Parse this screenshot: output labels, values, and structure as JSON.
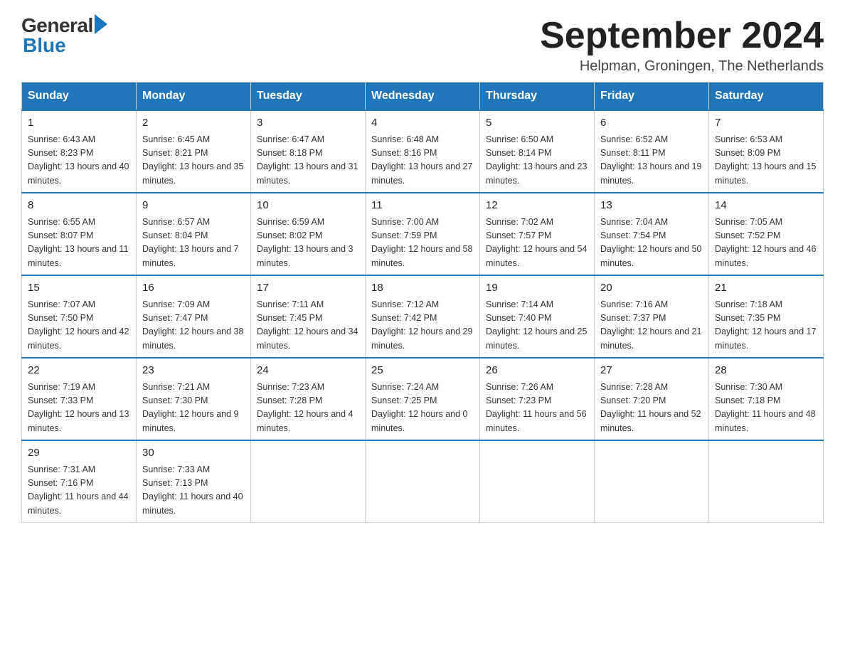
{
  "logo": {
    "general": "General",
    "blue": "Blue"
  },
  "header": {
    "month_year": "September 2024",
    "location": "Helpman, Groningen, The Netherlands"
  },
  "weekdays": [
    "Sunday",
    "Monday",
    "Tuesday",
    "Wednesday",
    "Thursday",
    "Friday",
    "Saturday"
  ],
  "weeks": [
    [
      {
        "day": "1",
        "sunrise": "6:43 AM",
        "sunset": "8:23 PM",
        "daylight": "13 hours and 40 minutes."
      },
      {
        "day": "2",
        "sunrise": "6:45 AM",
        "sunset": "8:21 PM",
        "daylight": "13 hours and 35 minutes."
      },
      {
        "day": "3",
        "sunrise": "6:47 AM",
        "sunset": "8:18 PM",
        "daylight": "13 hours and 31 minutes."
      },
      {
        "day": "4",
        "sunrise": "6:48 AM",
        "sunset": "8:16 PM",
        "daylight": "13 hours and 27 minutes."
      },
      {
        "day": "5",
        "sunrise": "6:50 AM",
        "sunset": "8:14 PM",
        "daylight": "13 hours and 23 minutes."
      },
      {
        "day": "6",
        "sunrise": "6:52 AM",
        "sunset": "8:11 PM",
        "daylight": "13 hours and 19 minutes."
      },
      {
        "day": "7",
        "sunrise": "6:53 AM",
        "sunset": "8:09 PM",
        "daylight": "13 hours and 15 minutes."
      }
    ],
    [
      {
        "day": "8",
        "sunrise": "6:55 AM",
        "sunset": "8:07 PM",
        "daylight": "13 hours and 11 minutes."
      },
      {
        "day": "9",
        "sunrise": "6:57 AM",
        "sunset": "8:04 PM",
        "daylight": "13 hours and 7 minutes."
      },
      {
        "day": "10",
        "sunrise": "6:59 AM",
        "sunset": "8:02 PM",
        "daylight": "13 hours and 3 minutes."
      },
      {
        "day": "11",
        "sunrise": "7:00 AM",
        "sunset": "7:59 PM",
        "daylight": "12 hours and 58 minutes."
      },
      {
        "day": "12",
        "sunrise": "7:02 AM",
        "sunset": "7:57 PM",
        "daylight": "12 hours and 54 minutes."
      },
      {
        "day": "13",
        "sunrise": "7:04 AM",
        "sunset": "7:54 PM",
        "daylight": "12 hours and 50 minutes."
      },
      {
        "day": "14",
        "sunrise": "7:05 AM",
        "sunset": "7:52 PM",
        "daylight": "12 hours and 46 minutes."
      }
    ],
    [
      {
        "day": "15",
        "sunrise": "7:07 AM",
        "sunset": "7:50 PM",
        "daylight": "12 hours and 42 minutes."
      },
      {
        "day": "16",
        "sunrise": "7:09 AM",
        "sunset": "7:47 PM",
        "daylight": "12 hours and 38 minutes."
      },
      {
        "day": "17",
        "sunrise": "7:11 AM",
        "sunset": "7:45 PM",
        "daylight": "12 hours and 34 minutes."
      },
      {
        "day": "18",
        "sunrise": "7:12 AM",
        "sunset": "7:42 PM",
        "daylight": "12 hours and 29 minutes."
      },
      {
        "day": "19",
        "sunrise": "7:14 AM",
        "sunset": "7:40 PM",
        "daylight": "12 hours and 25 minutes."
      },
      {
        "day": "20",
        "sunrise": "7:16 AM",
        "sunset": "7:37 PM",
        "daylight": "12 hours and 21 minutes."
      },
      {
        "day": "21",
        "sunrise": "7:18 AM",
        "sunset": "7:35 PM",
        "daylight": "12 hours and 17 minutes."
      }
    ],
    [
      {
        "day": "22",
        "sunrise": "7:19 AM",
        "sunset": "7:33 PM",
        "daylight": "12 hours and 13 minutes."
      },
      {
        "day": "23",
        "sunrise": "7:21 AM",
        "sunset": "7:30 PM",
        "daylight": "12 hours and 9 minutes."
      },
      {
        "day": "24",
        "sunrise": "7:23 AM",
        "sunset": "7:28 PM",
        "daylight": "12 hours and 4 minutes."
      },
      {
        "day": "25",
        "sunrise": "7:24 AM",
        "sunset": "7:25 PM",
        "daylight": "12 hours and 0 minutes."
      },
      {
        "day": "26",
        "sunrise": "7:26 AM",
        "sunset": "7:23 PM",
        "daylight": "11 hours and 56 minutes."
      },
      {
        "day": "27",
        "sunrise": "7:28 AM",
        "sunset": "7:20 PM",
        "daylight": "11 hours and 52 minutes."
      },
      {
        "day": "28",
        "sunrise": "7:30 AM",
        "sunset": "7:18 PM",
        "daylight": "11 hours and 48 minutes."
      }
    ],
    [
      {
        "day": "29",
        "sunrise": "7:31 AM",
        "sunset": "7:16 PM",
        "daylight": "11 hours and 44 minutes."
      },
      {
        "day": "30",
        "sunrise": "7:33 AM",
        "sunset": "7:13 PM",
        "daylight": "11 hours and 40 minutes."
      },
      null,
      null,
      null,
      null,
      null
    ]
  ]
}
